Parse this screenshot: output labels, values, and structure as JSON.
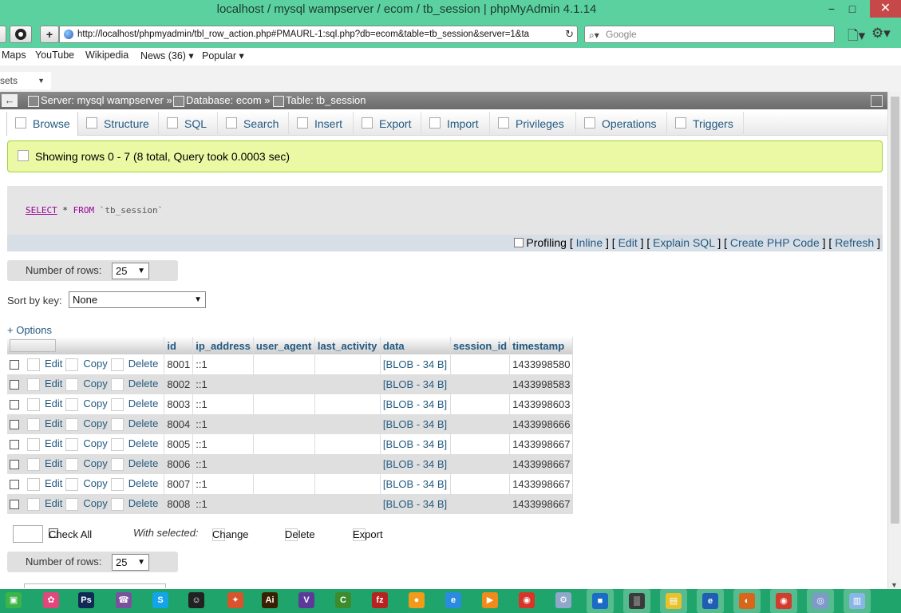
{
  "window": {
    "title": "localhost / mysql wampserver / ecom / tb_session | phpMyAdmin 4.1.14",
    "minimize": "−",
    "maximize": "□",
    "close": "✕"
  },
  "browser": {
    "url": "http://localhost/phpmyadmin/tbl_row_action.php#PMAURL-1:sql.php?db=ecom&table=tb_session&server=1&ta",
    "search_placeholder": "Google",
    "new_tab": "+",
    "reload": "↻",
    "bookmarks": [
      "Maps",
      "YouTube",
      "Wikipedia",
      "News (36) ▾",
      "Popular ▾"
    ],
    "sets_label": "sets"
  },
  "breadcrumb": {
    "back": "←",
    "server": "Server: mysql wampserver »",
    "database": "Database: ecom »",
    "table": "Table: tb_session"
  },
  "tabs": [
    "Browse",
    "Structure",
    "SQL",
    "Search",
    "Insert",
    "Export",
    "Import",
    "Privileges",
    "Operations",
    "Triggers"
  ],
  "notice": "Showing rows 0 - 7 (8 total, Query took 0.0003 sec)",
  "sql": {
    "select": "SELECT",
    "rest1": " * ",
    "from": "FROM",
    "table": " `tb_session`"
  },
  "sql_ops": {
    "profiling": "Profiling",
    "open_br": "[",
    "close_br": "]",
    "inline": "Inline",
    "edit": "Edit",
    "explain": "Explain SQL",
    "php": "Create PHP Code",
    "refresh": "Refresh"
  },
  "num_rows": {
    "label": "Number of rows:",
    "value": "25"
  },
  "sort": {
    "label": "Sort by key:",
    "value": "None"
  },
  "options_label": "+ Options",
  "table": {
    "columns": [
      "id",
      "ip_address",
      "user_agent",
      "last_activity",
      "data",
      "session_id",
      "timestamp"
    ],
    "actions": {
      "edit": "Edit",
      "copy": "Copy",
      "delete": "Delete"
    },
    "rows": [
      {
        "id": "8001",
        "ip_address": "::1",
        "user_agent": "",
        "last_activity": "",
        "data": "[BLOB - 34 B]",
        "session_id": "",
        "timestamp": "1433998580"
      },
      {
        "id": "8002",
        "ip_address": "::1",
        "user_agent": "",
        "last_activity": "",
        "data": "[BLOB - 34 B]",
        "session_id": "",
        "timestamp": "1433998583"
      },
      {
        "id": "8003",
        "ip_address": "::1",
        "user_agent": "",
        "last_activity": "",
        "data": "[BLOB - 34 B]",
        "session_id": "",
        "timestamp": "1433998603"
      },
      {
        "id": "8004",
        "ip_address": "::1",
        "user_agent": "",
        "last_activity": "",
        "data": "[BLOB - 34 B]",
        "session_id": "",
        "timestamp": "1433998666"
      },
      {
        "id": "8005",
        "ip_address": "::1",
        "user_agent": "",
        "last_activity": "",
        "data": "[BLOB - 34 B]",
        "session_id": "",
        "timestamp": "1433998667"
      },
      {
        "id": "8006",
        "ip_address": "::1",
        "user_agent": "",
        "last_activity": "",
        "data": "[BLOB - 34 B]",
        "session_id": "",
        "timestamp": "1433998667"
      },
      {
        "id": "8007",
        "ip_address": "::1",
        "user_agent": "",
        "last_activity": "",
        "data": "[BLOB - 34 B]",
        "session_id": "",
        "timestamp": "1433998667"
      },
      {
        "id": "8008",
        "ip_address": "::1",
        "user_agent": "",
        "last_activity": "",
        "data": "[BLOB - 34 B]",
        "session_id": "",
        "timestamp": "1433998667"
      }
    ]
  },
  "bulk": {
    "check_all": "Check All",
    "with_selected": "With selected:",
    "change": "Change",
    "delete": "Delete",
    "export": "Export"
  },
  "taskbar": [
    {
      "name": "start-app-icon",
      "color": "#3bb54a",
      "glyph": "▣"
    },
    {
      "name": "flower-app-icon",
      "color": "#e2467c",
      "glyph": "✿"
    },
    {
      "name": "photoshop-icon",
      "color": "#0f2a54",
      "glyph": "Ps"
    },
    {
      "name": "viber-icon",
      "color": "#7b519d",
      "glyph": "☎"
    },
    {
      "name": "skype-icon",
      "color": "#12a5e9",
      "glyph": "S"
    },
    {
      "name": "qq-icon",
      "color": "#222222",
      "glyph": "☺"
    },
    {
      "name": "firefox-dev-icon",
      "color": "#d8542c",
      "glyph": "✦"
    },
    {
      "name": "illustrator-icon",
      "color": "#3a1f00",
      "glyph": "Ai"
    },
    {
      "name": "visual-studio-icon",
      "color": "#5b3a9a",
      "glyph": "V"
    },
    {
      "name": "codeblocks-icon",
      "color": "#3c8b2d",
      "glyph": "C"
    },
    {
      "name": "filezilla-icon",
      "color": "#b8231f",
      "glyph": "fz"
    },
    {
      "name": "wamp-icon",
      "color": "#f29a1a",
      "glyph": "●"
    },
    {
      "name": "ie-icon",
      "color": "#2b8be0",
      "glyph": "e"
    },
    {
      "name": "media-player-icon",
      "color": "#f08a1a",
      "glyph": "▶"
    },
    {
      "name": "chrome-icon",
      "color": "#d8352a",
      "glyph": "◉"
    },
    {
      "name": "settings-app-icon",
      "color": "#8fa7c8",
      "glyph": "⚙"
    },
    {
      "name": "virtualbox-icon",
      "color": "#1b6cc4",
      "glyph": "■"
    },
    {
      "name": "calculator-icon",
      "color": "#3a3a3a",
      "glyph": "▒"
    },
    {
      "name": "file-explorer-icon",
      "color": "#e8c12f",
      "glyph": "▤"
    },
    {
      "name": "ie-pinned-icon",
      "color": "#1e5fb3",
      "glyph": "e"
    },
    {
      "name": "firefox-icon",
      "color": "#d7651a",
      "glyph": "◐"
    },
    {
      "name": "chrome-pinned-icon",
      "color": "#d33b2c",
      "glyph": "◉"
    },
    {
      "name": "app-pinned-icon",
      "color": "#7f99c8",
      "glyph": "◎"
    },
    {
      "name": "notepad-icon",
      "color": "#8ab6e6",
      "glyph": "▥"
    }
  ]
}
